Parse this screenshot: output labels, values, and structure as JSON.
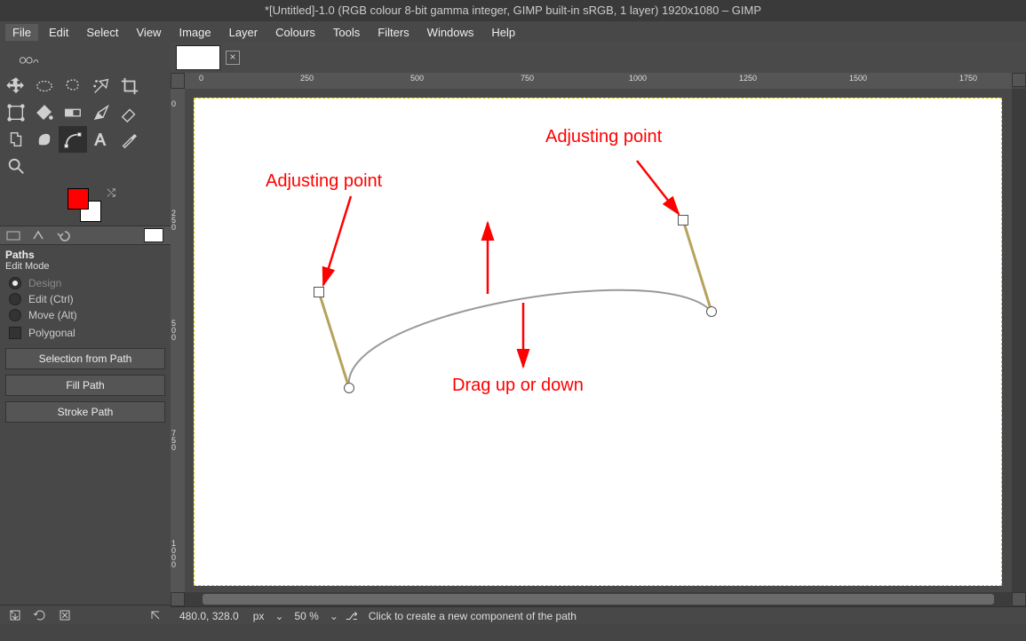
{
  "window": {
    "title": "*[Untitled]-1.0 (RGB colour 8-bit gamma integer, GIMP built-in sRGB, 1 layer) 1920x1080 – GIMP"
  },
  "menu": {
    "items": [
      "File",
      "Edit",
      "Select",
      "View",
      "Image",
      "Layer",
      "Colours",
      "Tools",
      "Filters",
      "Windows",
      "Help"
    ]
  },
  "panel": {
    "title": "Paths",
    "subtitle": "Edit Mode",
    "modes": [
      {
        "label": "Design",
        "checked": true,
        "dim": true
      },
      {
        "label": "Edit (Ctrl)",
        "checked": false,
        "dim": false
      },
      {
        "label": "Move (Alt)",
        "checked": false,
        "dim": false
      }
    ],
    "polygonal_label": "Polygonal",
    "buttons": {
      "selection": "Selection from Path",
      "fill": "Fill Path",
      "stroke": "Stroke Path"
    }
  },
  "swatch": {
    "fg": "#ff0000",
    "bg": "#ffffff"
  },
  "ruler": {
    "h_labels": [
      "0",
      "250",
      "500",
      "750",
      "1000",
      "1250",
      "1500",
      "1750"
    ],
    "v_labels": [
      "0",
      "250",
      "500",
      "750",
      "1000"
    ]
  },
  "annotations": {
    "adj1": "Adjusting point",
    "adj2": "Adjusting point",
    "drag": "Drag up or down"
  },
  "status": {
    "coords": "480.0, 328.0",
    "unit": "px",
    "zoom": "50 %",
    "hint": "Click to create a new component of the path"
  },
  "icons": {
    "move": "move-tool-icon",
    "rect-select": "rect-select-icon",
    "free-select": "free-select-icon",
    "fuzzy-select": "fuzzy-select-icon",
    "crop": "crop-icon",
    "transform": "transform-icon",
    "warp": "warp-icon",
    "bucket": "bucket-icon",
    "brush": "brush-icon",
    "eraser": "eraser-icon",
    "clone": "clone-icon",
    "smudge": "smudge-icon",
    "paths": "paths-icon",
    "text": "text-icon",
    "picker": "picker-icon",
    "zoom": "zoom-icon"
  }
}
